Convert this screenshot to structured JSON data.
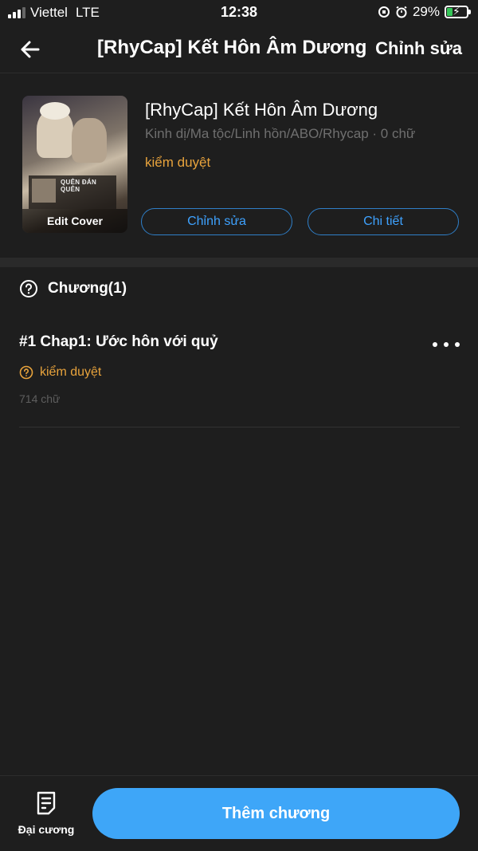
{
  "status_bar": {
    "carrier": "Viettel",
    "network": "LTE",
    "time": "12:38",
    "battery_percent": "29%",
    "battery_level": 0.29,
    "battery_color": "#36c759"
  },
  "navbar": {
    "back_icon": "arrow-left-icon",
    "title": "[RhyCap] Kết Hôn Âm Dương",
    "edit_label": "Chỉnh sửa"
  },
  "book": {
    "cover_label": "Edit Cover",
    "cover_inner_title": "QUÊN ĐÁN QUÊN",
    "title": "[RhyCap] Kết Hôn Âm Dương",
    "meta": "Kinh dị/Ma tộc/Linh hồn/ABO/Rhycap · 0 chữ",
    "status": "kiểm duyệt",
    "edit_button": "Chỉnh sửa",
    "detail_button": "Chi tiết"
  },
  "chapters": {
    "header_icon": "question-circle-icon",
    "label": "Chương(1)",
    "items": [
      {
        "title": "#1 Chap1: Ước hôn với quỷ",
        "status": "kiểm duyệt",
        "words": "714 chữ"
      }
    ]
  },
  "bottom_bar": {
    "outline_icon": "document-icon",
    "outline_label": "Đại cương",
    "add_button": "Thêm chương"
  },
  "colors": {
    "background": "#1e1e1e",
    "accent_blue": "#3ea6f8",
    "status_orange": "#e8a33c"
  }
}
